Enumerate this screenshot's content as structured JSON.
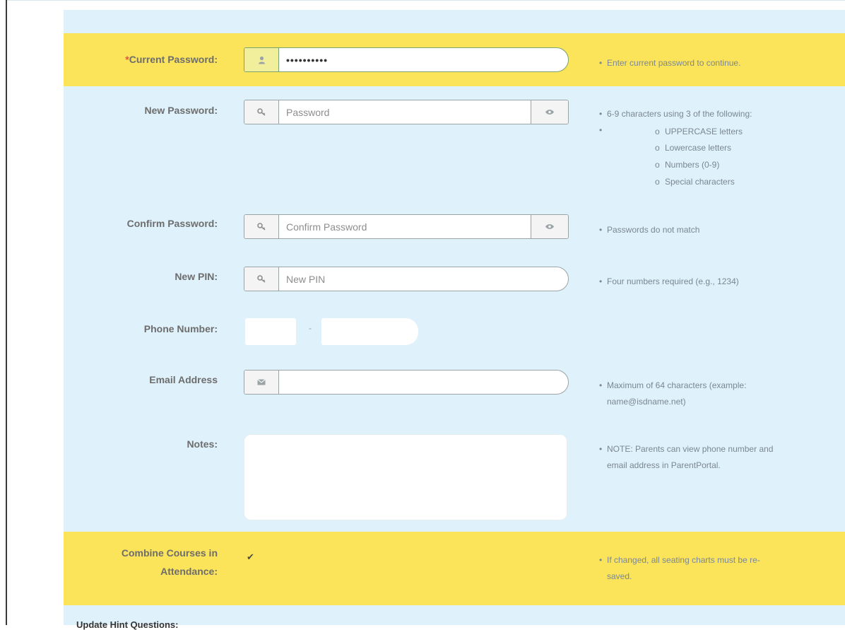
{
  "form": {
    "current_password": {
      "required_mark": "*",
      "label": "Current Password:",
      "value": "••••••••••",
      "icon": "user-icon",
      "hint": "Enter current password to continue."
    },
    "new_password": {
      "label": "New Password:",
      "placeholder": "Password",
      "icon": "key-icon",
      "toggle_icon": "eye-icon",
      "hint": "6-9 characters using 3 of the following:",
      "hint_empty_bullet": "•",
      "rules": [
        "UPPERCASE letters",
        "Lowercase letters",
        "Numbers (0-9)",
        "Special characters"
      ]
    },
    "confirm_password": {
      "label": "Confirm Password:",
      "placeholder": "Confirm Password",
      "icon": "key-icon",
      "toggle_icon": "eye-icon",
      "hint": "Passwords do not match"
    },
    "new_pin": {
      "label": "New PIN:",
      "placeholder": "New PIN",
      "icon": "key-icon",
      "hint": "Four numbers required (e.g., 1234)"
    },
    "phone_number": {
      "label": "Phone Number:",
      "separator": "-"
    },
    "email_address": {
      "label": "Email Address",
      "icon": "envelope-icon",
      "hint_line1": "Maximum of 64 characters (example:",
      "hint_line2": "name@isdname.net)"
    },
    "notes": {
      "label": "Notes:",
      "hint_line1": "NOTE: Parents can view phone number and",
      "hint_line2": "email address in ParentPortal."
    },
    "combine_courses": {
      "label_line1": "Combine Courses in",
      "label_line2": "Attendance:",
      "check_mark": "✔",
      "hint_line1": "If changed, all seating charts must be re-",
      "hint_line2": "saved."
    },
    "next_section": "Update Hint Questions:"
  },
  "bullet": "•",
  "sub_bullet": "o",
  "colors": {
    "panel": "#dff1fb",
    "highlight": "#fbe35a",
    "required": "#e0573f"
  }
}
